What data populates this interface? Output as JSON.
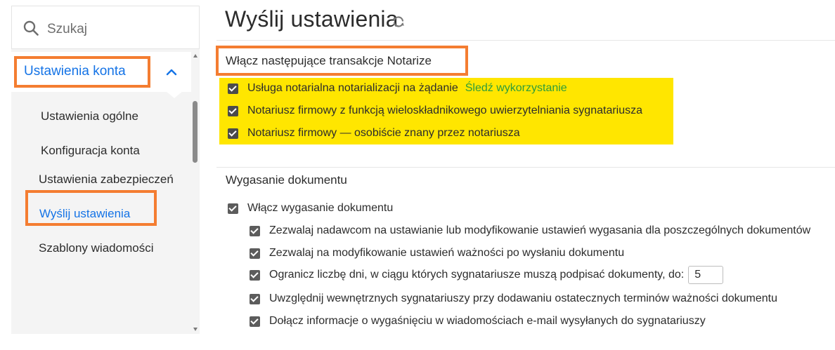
{
  "search": {
    "placeholder": "Szukaj"
  },
  "sidebar": {
    "section_title": "Ustawienia konta",
    "items": [
      {
        "label": "Ustawienia ogólne"
      },
      {
        "label": "Konfiguracja konta"
      },
      {
        "label": "Ustawienia zabezpieczeń"
      },
      {
        "label": "Wyślij ustawienia",
        "active": true
      },
      {
        "label": "Szablony wiadomości"
      }
    ]
  },
  "page": {
    "title": "Wyślij ustawienia"
  },
  "notarize": {
    "heading": "Włącz następujące transakcje Notarize",
    "options": [
      {
        "label": "Usługa notarialna notarializacji na żądanie",
        "checked": true,
        "link": "Śledź wykorzystanie"
      },
      {
        "label": "Notariusz firmowy z funkcją wieloskładnikowego uwierzytelniania sygnatariusza",
        "checked": true
      },
      {
        "label": "Notariusz firmowy — osobiście znany przez notariusza",
        "checked": true
      }
    ]
  },
  "expiration": {
    "heading": "Wygasanie dokumentu",
    "enable_label": "Włącz wygasanie dokumentu",
    "options": [
      {
        "label": "Zezwalaj nadawcom na ustawianie lub modyfikowanie ustawień wygasania dla poszczególnych dokumentów",
        "checked": true
      },
      {
        "label": "Zezwalaj na modyfikowanie ustawień ważności po wysłaniu dokumentu",
        "checked": true
      },
      {
        "label": "Ogranicz liczbę dni, w ciągu których sygnatariusze muszą podpisać dokumenty, do:",
        "checked": true,
        "days_value": "5"
      },
      {
        "label": "Uwzględnij wewnętrznych sygnatariuszy przy dodawaniu ostatecznych terminów ważności dokumentu",
        "checked": true
      },
      {
        "label": "Dołącz informacje o wygaśnięciu w wiadomościach e-mail wysyłanych do sygnatariuszy",
        "checked": true
      }
    ]
  },
  "colors": {
    "accent_blue": "#1473e6",
    "highlight_orange": "#f47d31",
    "highlight_yellow": "#ffe600",
    "link_green": "#2d9d3a"
  },
  "icons": [
    "search-icon",
    "chevron-up-icon",
    "refresh-icon",
    "checkbox-checked-icon"
  ]
}
